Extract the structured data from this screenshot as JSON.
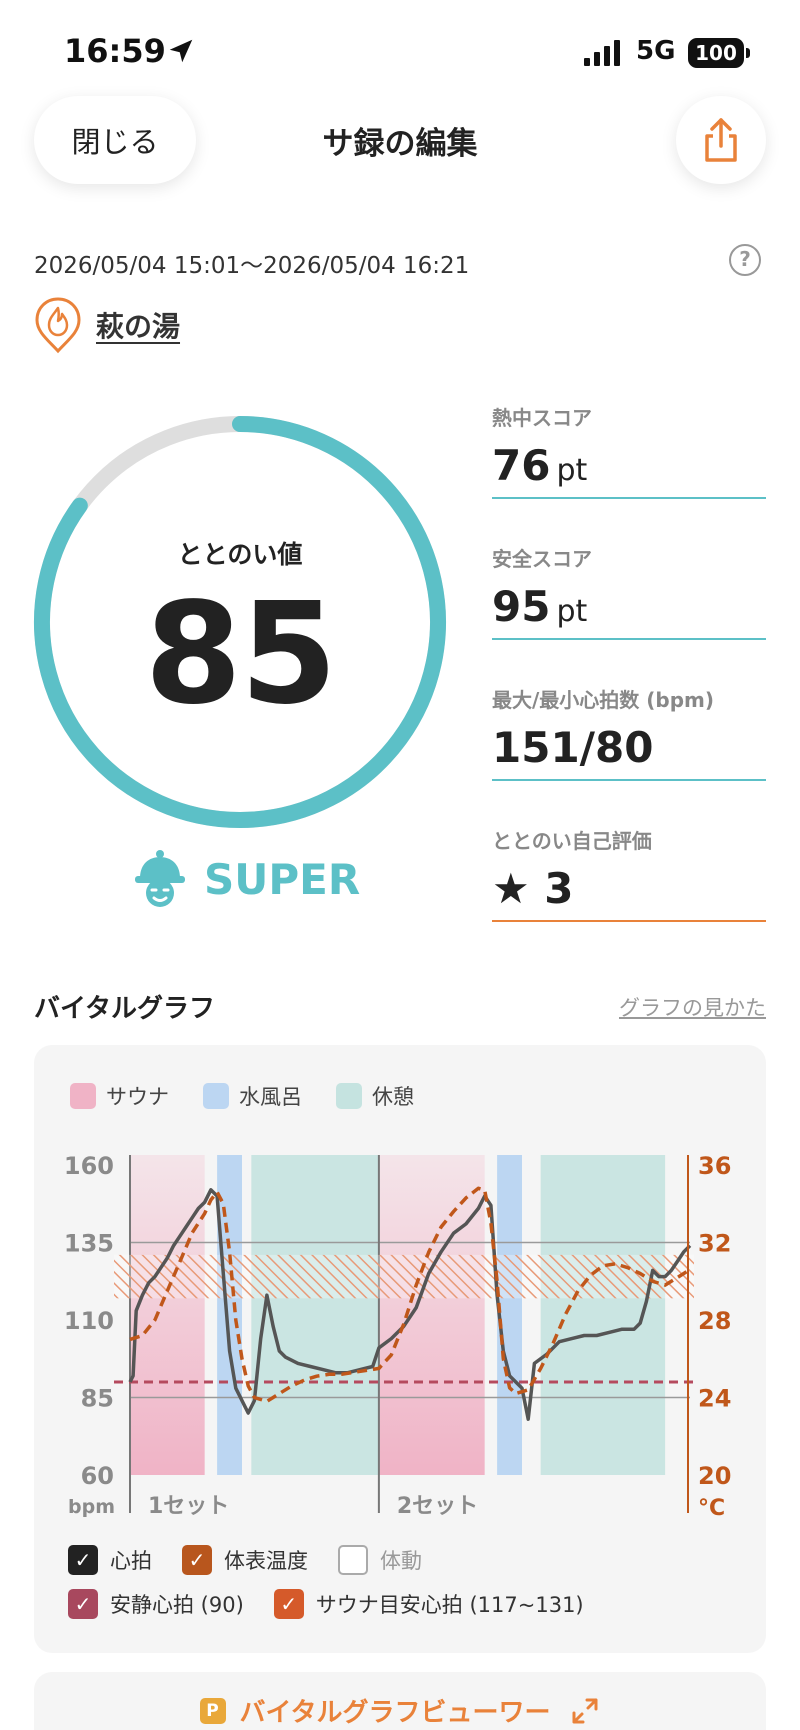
{
  "status_bar": {
    "time": "16:59",
    "network": "5G",
    "battery": "100"
  },
  "header": {
    "close_label": "閉じる",
    "title": "サ録の編集"
  },
  "session": {
    "date_range": "2026/05/04 15:01〜2026/05/04 16:21",
    "facility": "萩の湯"
  },
  "totonoi": {
    "label": "ととのい値",
    "value": "85",
    "fraction": 0.85,
    "rank": "SUPER"
  },
  "metrics": [
    {
      "label": "熱中スコア",
      "value": "76",
      "unit": "pt"
    },
    {
      "label": "安全スコア",
      "value": "95",
      "unit": "pt"
    },
    {
      "label": "最大/最小心拍数 (bpm)",
      "value": "151/80",
      "unit": ""
    }
  ],
  "rating": {
    "label": "ととのい自己評価",
    "value": "3"
  },
  "vital": {
    "title": "バイタルグラフ",
    "help_link": "グラフの見かた"
  },
  "colors": {
    "accent": "#5cc0c7",
    "orange": "#e9823a",
    "sauna": "#f0b3c6",
    "water": "#bcd6f2",
    "rest": "#c5e3e0",
    "temp_line": "#c0571a",
    "heart_line": "#555555",
    "resting": "#b54a5e"
  },
  "chart_data": {
    "type": "line",
    "legend_phases": [
      "サウナ",
      "水風呂",
      "休憩"
    ],
    "y_left": {
      "label": "bpm",
      "ticks": [
        160,
        135,
        110,
        85,
        60
      ],
      "range": [
        60,
        160
      ]
    },
    "y_right": {
      "label": "°C",
      "ticks": [
        36,
        32,
        28,
        24,
        20
      ],
      "range": [
        20,
        36
      ]
    },
    "set_labels": [
      "1セット",
      "2セット"
    ],
    "phases": [
      {
        "type": "sauna",
        "start": 0,
        "end": 12
      },
      {
        "type": "water",
        "start": 14,
        "end": 18
      },
      {
        "type": "rest",
        "start": 19.5,
        "end": 40
      },
      {
        "type": "sauna",
        "start": 40,
        "end": 57
      },
      {
        "type": "water",
        "start": 59,
        "end": 63
      },
      {
        "type": "rest",
        "start": 66,
        "end": 86
      }
    ],
    "resting_hr": 90,
    "sauna_target_hr": [
      117,
      131
    ],
    "series": [
      {
        "name": "心拍",
        "unit": "bpm",
        "points": [
          [
            0,
            90
          ],
          [
            0.5,
            92
          ],
          [
            1,
            113
          ],
          [
            2,
            118
          ],
          [
            3,
            122
          ],
          [
            4,
            124
          ],
          [
            5,
            127
          ],
          [
            6,
            130
          ],
          [
            7,
            134
          ],
          [
            8,
            137
          ],
          [
            9,
            140
          ],
          [
            10,
            143
          ],
          [
            11,
            146
          ],
          [
            12,
            148
          ],
          [
            13,
            152
          ],
          [
            14,
            150
          ],
          [
            15,
            125
          ],
          [
            16,
            100
          ],
          [
            17,
            88
          ],
          [
            18,
            84
          ],
          [
            19,
            80
          ],
          [
            20,
            84
          ],
          [
            21,
            104
          ],
          [
            22,
            118
          ],
          [
            23,
            108
          ],
          [
            24,
            100
          ],
          [
            25,
            98
          ],
          [
            27,
            96
          ],
          [
            29,
            95
          ],
          [
            31,
            94
          ],
          [
            33,
            93
          ],
          [
            35,
            93
          ],
          [
            37,
            94
          ],
          [
            39,
            95
          ],
          [
            40,
            101
          ],
          [
            42,
            104
          ],
          [
            44,
            108
          ],
          [
            46,
            114
          ],
          [
            48,
            125
          ],
          [
            50,
            132
          ],
          [
            52,
            138
          ],
          [
            54,
            141
          ],
          [
            56,
            146
          ],
          [
            57,
            150
          ],
          [
            58,
            147
          ],
          [
            59,
            118
          ],
          [
            60,
            100
          ],
          [
            61,
            92
          ],
          [
            62,
            90
          ],
          [
            63,
            88
          ],
          [
            64,
            78
          ],
          [
            65,
            96
          ],
          [
            67,
            99
          ],
          [
            69,
            103
          ],
          [
            71,
            104
          ],
          [
            73,
            105
          ],
          [
            75,
            105
          ],
          [
            77,
            106
          ],
          [
            79,
            107
          ],
          [
            81,
            107
          ],
          [
            82,
            109
          ],
          [
            83,
            116
          ],
          [
            84,
            126
          ],
          [
            85,
            124
          ],
          [
            86,
            124
          ],
          [
            87,
            126
          ],
          [
            88,
            129
          ],
          [
            89,
            132
          ],
          [
            90,
            134
          ]
        ]
      },
      {
        "name": "体表温度",
        "unit": "°C",
        "points": [
          [
            0,
            27
          ],
          [
            2,
            27.2
          ],
          [
            4,
            28
          ],
          [
            6,
            29.5
          ],
          [
            8,
            31
          ],
          [
            10,
            32.5
          ],
          [
            12,
            33.5
          ],
          [
            13,
            34.2
          ],
          [
            14,
            34.6
          ],
          [
            15,
            34
          ],
          [
            16,
            31.5
          ],
          [
            17,
            28
          ],
          [
            18,
            26
          ],
          [
            19,
            24.6
          ],
          [
            20,
            24
          ],
          [
            22,
            23.8
          ],
          [
            24,
            24.2
          ],
          [
            26,
            24.6
          ],
          [
            28,
            24.9
          ],
          [
            30,
            25.1
          ],
          [
            32,
            25.2
          ],
          [
            34,
            25.2
          ],
          [
            36,
            25.3
          ],
          [
            38,
            25.4
          ],
          [
            40,
            25.5
          ],
          [
            42,
            26.2
          ],
          [
            44,
            27.8
          ],
          [
            46,
            29.8
          ],
          [
            48,
            31.5
          ],
          [
            50,
            32.8
          ],
          [
            52,
            33.6
          ],
          [
            54,
            34.3
          ],
          [
            56,
            34.8
          ],
          [
            57,
            34.7
          ],
          [
            58,
            33
          ],
          [
            59,
            30
          ],
          [
            60,
            26
          ],
          [
            61,
            24.5
          ],
          [
            62,
            24.2
          ],
          [
            64,
            24.4
          ],
          [
            66,
            25.5
          ],
          [
            68,
            26.8
          ],
          [
            70,
            28.3
          ],
          [
            72,
            29.5
          ],
          [
            74,
            30.3
          ],
          [
            76,
            30.8
          ],
          [
            78,
            30.9
          ],
          [
            80,
            30.7
          ],
          [
            82,
            30.4
          ],
          [
            84,
            30.0
          ],
          [
            86,
            29.8
          ],
          [
            88,
            30.2
          ],
          [
            90,
            30.6
          ]
        ]
      }
    ]
  },
  "legend_checks": [
    {
      "label": "心拍",
      "checked": true,
      "color": "#222222"
    },
    {
      "label": "体表温度",
      "checked": true,
      "color": "#b8561d"
    },
    {
      "label": "体動",
      "checked": false,
      "color": "#ffffff"
    },
    {
      "label": "安静心拍 (90)",
      "checked": true,
      "color": "#a8485e"
    },
    {
      "label": "サウナ目安心拍 (117~131)",
      "checked": true,
      "color": "#d55a2a"
    }
  ],
  "viewer": {
    "badge": "P",
    "label": "バイタルグラフビューワー"
  }
}
